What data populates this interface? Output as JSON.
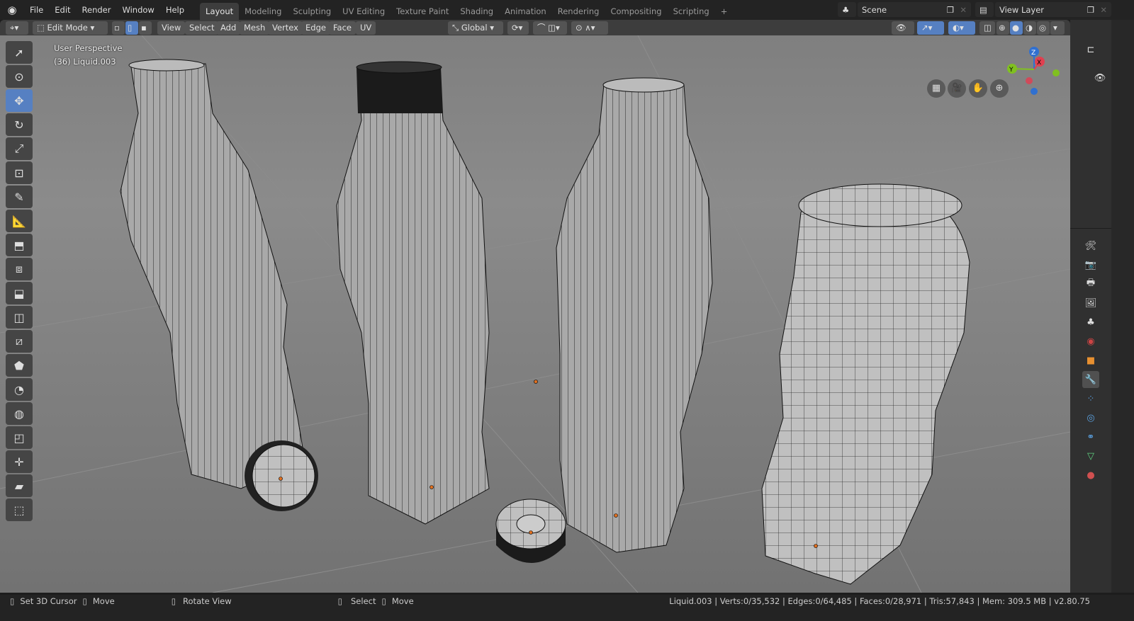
{
  "topbar": {
    "menus": [
      "File",
      "Edit",
      "Render",
      "Window",
      "Help"
    ],
    "workspaces": [
      "Layout",
      "Modeling",
      "Sculpting",
      "UV Editing",
      "Texture Paint",
      "Shading",
      "Animation",
      "Rendering",
      "Compositing",
      "Scripting"
    ],
    "active_workspace": "Layout",
    "add_workspace": "+",
    "scene": "Scene",
    "view_layer": "View Layer"
  },
  "header": {
    "mode": "Edit Mode",
    "menus": [
      "View",
      "Select",
      "Add",
      "Mesh",
      "Vertex",
      "Edge",
      "Face",
      "UV"
    ],
    "orientation": "Global",
    "select_mode_active": "edge"
  },
  "viewport": {
    "perspective": "User Perspective",
    "object": "(36) Liquid.003",
    "gizmo_axes": [
      "X",
      "Y",
      "Z"
    ]
  },
  "toolbar": {
    "tools": [
      "select-box",
      "cursor",
      "move",
      "rotate",
      "scale",
      "transform",
      "annotate",
      "measure",
      "extrude-region",
      "inset-faces",
      "bevel",
      "loop-cut",
      "knife",
      "poly-build",
      "spin",
      "smooth",
      "edge-slide",
      "shrink-fatten",
      "shear",
      "rip-region"
    ],
    "active": "move"
  },
  "status": {
    "left": [
      {
        "icon": "mouse-left",
        "label": "Set 3D Cursor"
      },
      {
        "icon": "mouse-drag",
        "label": "Move"
      },
      {
        "icon": "mouse-middle",
        "label": "Rotate View"
      },
      {
        "icon": "mouse-left",
        "label": "Select"
      },
      {
        "icon": "mouse-drag",
        "label": "Move"
      }
    ],
    "stats": "Liquid.003 | Verts:0/35,532 | Edges:0/64,485 | Faces:0/28,971 | Tris:57,843 | Mem: 309.5 MB | v2.80.75"
  },
  "colors": {
    "accent": "#5680c2",
    "viewport": "#808080",
    "axis_x": "#e04050",
    "axis_y": "#80c020",
    "axis_z": "#3070d0"
  }
}
